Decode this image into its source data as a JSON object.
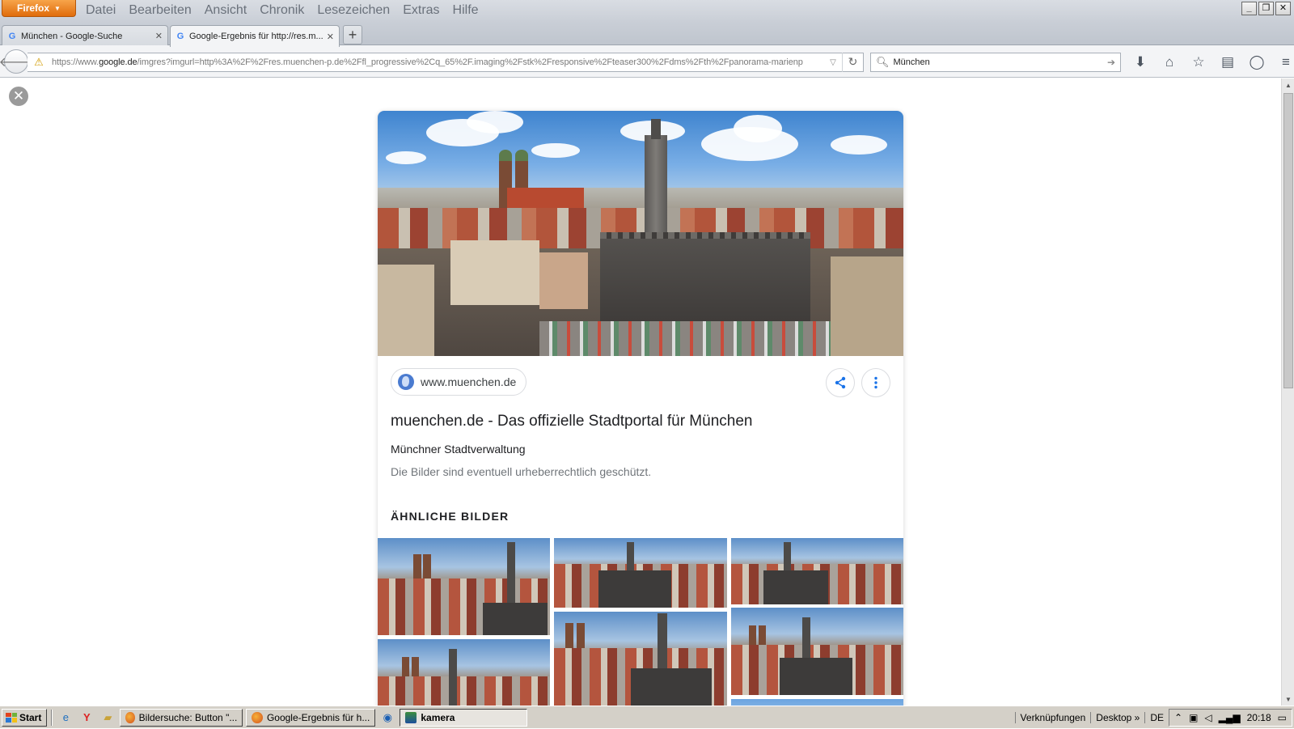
{
  "browser": {
    "firefox_button": "Firefox",
    "menu": [
      "Datei",
      "Bearbeiten",
      "Ansicht",
      "Chronik",
      "Lesezeichen",
      "Extras",
      "Hilfe"
    ],
    "tabs": [
      {
        "label": "München - Google-Suche",
        "active": false
      },
      {
        "label": "Google-Ergebnis für http://res.m...",
        "active": true
      }
    ],
    "url": {
      "prefix": "https://www.",
      "domain": "google.de",
      "rest": "/imgres?imgurl=http%3A%2F%2Fres.muenchen-p.de%2Ffl_progressive%2Cq_65%2F.imaging%2Fstk%2Fresponsive%2Fteaser300%2Fdms%2Fth%2Fpanorama-marienp"
    },
    "search_value": "München"
  },
  "result": {
    "source": "www.muenchen.de",
    "title": "muenchen.de - Das offizielle Stadtportal für München",
    "subtitle": "Münchner Stadtverwaltung",
    "note": "Die Bilder sind eventuell urheberrechtlich geschützt.",
    "similar_heading": "ÄHNLICHE BILDER"
  },
  "taskbar": {
    "start": "Start",
    "tasks": [
      {
        "label": "Bildersuche: Button \"...",
        "pressed": false
      },
      {
        "label": "Google-Ergebnis für h...",
        "pressed": false
      },
      {
        "label": "kamera",
        "pressed": true
      }
    ],
    "links": "Verknüpfungen",
    "desktop": "Desktop",
    "language": "DE",
    "clock": "20:18"
  },
  "colors": {
    "firefox_orange": "#e76f0f",
    "link_blue": "#1a73e8",
    "taskbar_gray": "#d4d0c8"
  }
}
